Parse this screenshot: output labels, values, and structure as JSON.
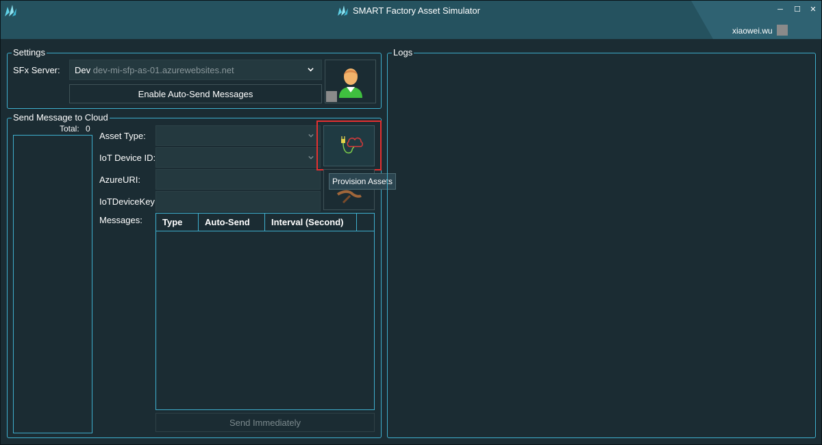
{
  "window": {
    "title": "SMART Factory Asset Simulator",
    "username": "xiaowei.wu",
    "controls": {
      "minimize": "─",
      "maximize": "☐",
      "close": "✕"
    }
  },
  "settings": {
    "group_title": "Settings",
    "server_label": "SFx Server:",
    "server_env": "Dev",
    "server_url": "dev-mi-sfp-as-01.azurewebsites.net",
    "auto_send_button": "Enable Auto-Send Messages",
    "user_icon": "user-avatar-icon"
  },
  "send": {
    "group_title": "Send Message to Cloud",
    "total_label": "Total:",
    "total_value": "0",
    "asset_type_label": "Asset Type:",
    "asset_type_value": "",
    "device_id_label": "IoT Device ID:",
    "device_id_value": "",
    "azure_uri_label": "AzureURI:",
    "azure_uri_value": "",
    "device_key_label": "IoTDeviceKey:",
    "device_key_value": "",
    "messages_label": "Messages:",
    "columns": [
      "Type",
      "Auto-Send",
      "Interval (Second)"
    ],
    "rows": [],
    "send_button": "Send Immediately",
    "provision_icon": "plug-cloud-icon",
    "tooltip": "Provision Assets"
  },
  "logs": {
    "group_title": "Logs"
  },
  "colors": {
    "background": "#1b2c33",
    "titlebar": "#25525f",
    "border_accent": "#3fb0cf",
    "highlight": "#e53030"
  }
}
